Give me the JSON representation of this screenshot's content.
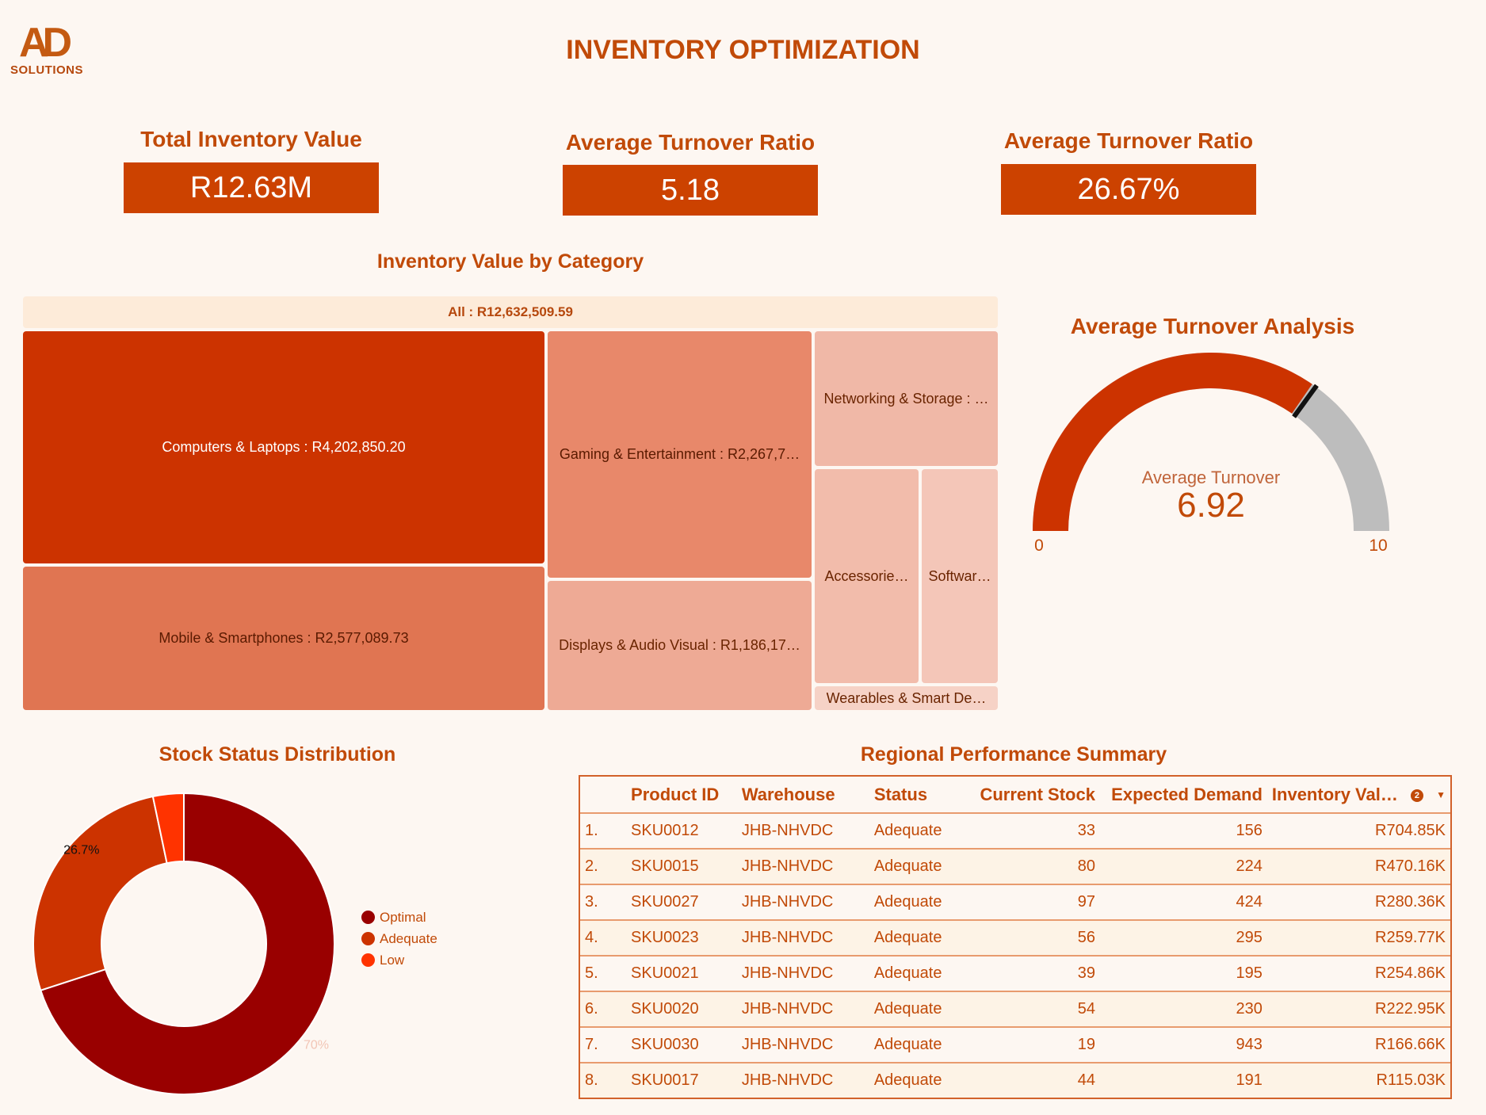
{
  "logo": {
    "mark": "AD",
    "text": "SOLUTIONS"
  },
  "title": "INVENTORY OPTIMIZATION",
  "kpis": [
    {
      "label": "Total Inventory Value",
      "value": "R12.63M"
    },
    {
      "label": "Average Turnover Ratio",
      "value": "5.18"
    },
    {
      "label": "Average Turnover Ratio",
      "value": "26.67%"
    }
  ],
  "treemap": {
    "title": "Inventory Value by Category",
    "root_label": "All : R12,632,509.59",
    "colors": {
      "dark": "#cc3300",
      "mid": "#e07552",
      "midlight": "#e8886a",
      "light": "#eeaa95",
      "lighter": "#f0b8a7",
      "lightest": "#f4c6b8",
      "pale": "#f6d2c6"
    },
    "cells": [
      {
        "label": "Computers & Laptops : R4,202,850.20",
        "value": 4202850.2
      },
      {
        "label": "Mobile & Smartphones : R2,577,089.73",
        "value": 2577089.73
      },
      {
        "label": "Gaming & Entertainment : R2,267,7…"
      },
      {
        "label": "Displays & Audio Visual : R1,186,17…"
      },
      {
        "label": "Networking & Storage : …"
      },
      {
        "label": "Accessorie…"
      },
      {
        "label": "Softwar…"
      },
      {
        "label": "Wearables & Smart De…"
      }
    ]
  },
  "gauge": {
    "title": "Average Turnover Analysis",
    "label": "Average Turnover",
    "value_text": "6.92",
    "value": 6.92,
    "min": 0,
    "max": 10,
    "target": 7,
    "min_label": "0",
    "max_label": "10",
    "fill_color": "#cc3300",
    "track_color": "#bdbdbd"
  },
  "donut": {
    "title": "Stock Status Distribution",
    "chart_data": {
      "type": "pie",
      "categories": [
        "Optimal",
        "Adequate",
        "Low"
      ],
      "values": [
        70,
        26.7,
        3.3
      ],
      "colors": [
        "#990000",
        "#cc3300",
        "#ff3300"
      ],
      "data_labels": [
        "70%",
        "26.7%",
        ""
      ]
    },
    "legend": [
      "Optimal",
      "Adequate",
      "Low"
    ]
  },
  "table": {
    "title": "Regional Performance Summary",
    "headers": [
      "",
      "Product ID",
      "Warehouse",
      "Status",
      "Current Stock",
      "Expected Demand",
      "Inventory Val…"
    ],
    "sort_badge": "2",
    "rows": [
      [
        "1.",
        "SKU0012",
        "JHB-NHVDC",
        "Adequate",
        "33",
        "156",
        "R704.85K"
      ],
      [
        "2.",
        "SKU0015",
        "JHB-NHVDC",
        "Adequate",
        "80",
        "224",
        "R470.16K"
      ],
      [
        "3.",
        "SKU0027",
        "JHB-NHVDC",
        "Adequate",
        "97",
        "424",
        "R280.36K"
      ],
      [
        "4.",
        "SKU0023",
        "JHB-NHVDC",
        "Adequate",
        "56",
        "295",
        "R259.77K"
      ],
      [
        "5.",
        "SKU0021",
        "JHB-NHVDC",
        "Adequate",
        "39",
        "195",
        "R254.86K"
      ],
      [
        "6.",
        "SKU0020",
        "JHB-NHVDC",
        "Adequate",
        "54",
        "230",
        "R222.95K"
      ],
      [
        "7.",
        "SKU0030",
        "JHB-NHVDC",
        "Adequate",
        "19",
        "943",
        "R166.66K"
      ],
      [
        "8.",
        "SKU0017",
        "JHB-NHVDC",
        "Adequate",
        "44",
        "191",
        "R115.03K"
      ]
    ]
  }
}
